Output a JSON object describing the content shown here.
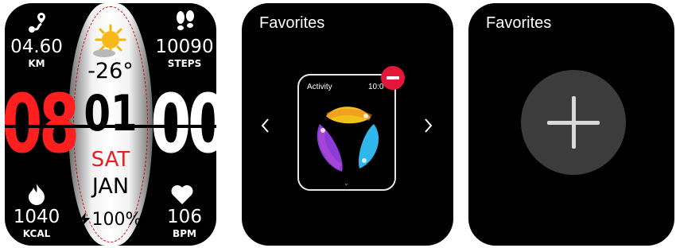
{
  "watch_face": {
    "distance": {
      "value": "04.60",
      "unit": "KM",
      "icon": "route-pin-icon"
    },
    "steps": {
      "value": "10090",
      "unit": "STEPS",
      "icon": "footprints-icon"
    },
    "calories": {
      "value": "1040",
      "unit": "KCAL",
      "icon": "flame-icon"
    },
    "heart_rate": {
      "value": "106",
      "unit": "BPM",
      "icon": "heart-icon"
    },
    "weather": {
      "temperature": "-26°",
      "icon": "sun-cloud-icon"
    },
    "time": {
      "hour": "08",
      "minute": "00"
    },
    "date": {
      "day": "01",
      "weekday": "SAT",
      "month": "JAN"
    },
    "battery": {
      "level": "100%",
      "icon": "lightning-icon"
    },
    "colors": {
      "hour": "#ff1f1f",
      "weekday": "#e8201f",
      "accent_ring": "#d00000"
    }
  },
  "favorites_edit": {
    "title": "Favorites",
    "card": {
      "title": "Activity",
      "time": "10:0",
      "icon": "activity-rings-icon"
    },
    "remove_icon": "minus-circle-icon",
    "nav": {
      "prev_icon": "chevron-left-icon",
      "next_icon": "chevron-right-icon"
    },
    "colors": {
      "remove": "#e3173a"
    }
  },
  "favorites_add": {
    "title": "Favorites",
    "add_icon": "plus-icon"
  }
}
